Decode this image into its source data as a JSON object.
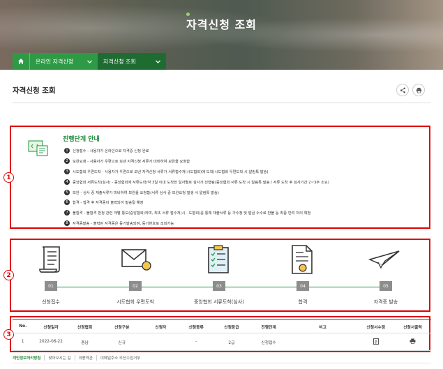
{
  "hero": {
    "title": "자격신청 조회"
  },
  "nav": {
    "home_icon": "home-icon",
    "items": [
      {
        "label": "온라인 자격신청"
      },
      {
        "label": "자격신청 조회"
      }
    ]
  },
  "page": {
    "title": "자격신청 조회"
  },
  "actions": {
    "share_icon": "share-icon",
    "print_icon": "print-icon"
  },
  "guide": {
    "title": "진행단계 안내",
    "steps": [
      "신청접수 - 사용자가 온라인으로 자격증 신청 완료",
      "보완요청 - 사용자가 우편으로 보낸 자격신청 서류가 미비하여 보완을 요청함",
      "시도협회 우편도착 - 사용자가 우편으로 보낸 자격신청 서류가 서류접수처(시도협회)에 도착(시도협회 우편도착 시 알림톡 발송)",
      "중앙협회 서류도착(심사) - 중앙협회에 서류도착(약 3일 이내 도착한 일자별로 심사가 진행됨(중앙협회 서류 도착 시 알림톡 발송 / 서류 도착 후 심사기간 2~3주 소요)",
      "보완 - 심사 중 재출서류가 미비하여 보완을 요청함(서류 심사 중 보완요청 발생 시 알림톡 발송)",
      "합격 - 합격 후 자격증이 출력되어 발송될 예정",
      "불합격 - 불합격 판정 관련 개별 통보(중앙협회)하며, 최초 서류 접수처(시 · 도협회)를 통해 재출서류 등 가수정 및 발급 수수료 환불 등 최종 반려 처리 예정",
      "자격증발송 - 출력된 자격증은 등기발송되며, 등기번호로 조회가능"
    ]
  },
  "flow": {
    "steps": [
      {
        "num": "01",
        "label": "신청접수",
        "icon": "document-scroll-icon"
      },
      {
        "num": "02",
        "label": "시도협회 우편도착",
        "icon": "envelope-icon"
      },
      {
        "num": "03",
        "label": "중앙협회 서류도착(심사)",
        "icon": "clipboard-checklist-icon"
      },
      {
        "num": "04",
        "label": "합격",
        "icon": "certificate-icon"
      },
      {
        "num": "05",
        "label": "자격증 발송",
        "icon": "paper-plane-icon"
      }
    ]
  },
  "table": {
    "headers": [
      "No.",
      "신청일자",
      "신청협회",
      "신청구분",
      "신청자",
      "신청종류",
      "신청등급",
      "진행단계",
      "비고",
      "신청서수정",
      "신청서출력"
    ],
    "rows": [
      {
        "no": "1",
        "date": "2022-06-22",
        "assoc": "충남",
        "type": "신규",
        "applicant": "",
        "kind": "-",
        "grade": "2급",
        "stage": "신청접수",
        "note": "",
        "edit_icon": "edit-form-icon",
        "print_icon": "print-icon"
      }
    ]
  },
  "footer": {
    "links": [
      "개인정보처리방침",
      "찾아오시는 길",
      "이용약관",
      "이메일주소 무단수집거부"
    ]
  },
  "annotations": [
    "1",
    "2",
    "3"
  ],
  "colors": {
    "accent_green": "#2f9a45",
    "dark_green": "#1f6c33",
    "highlight_red": "#e00000"
  }
}
